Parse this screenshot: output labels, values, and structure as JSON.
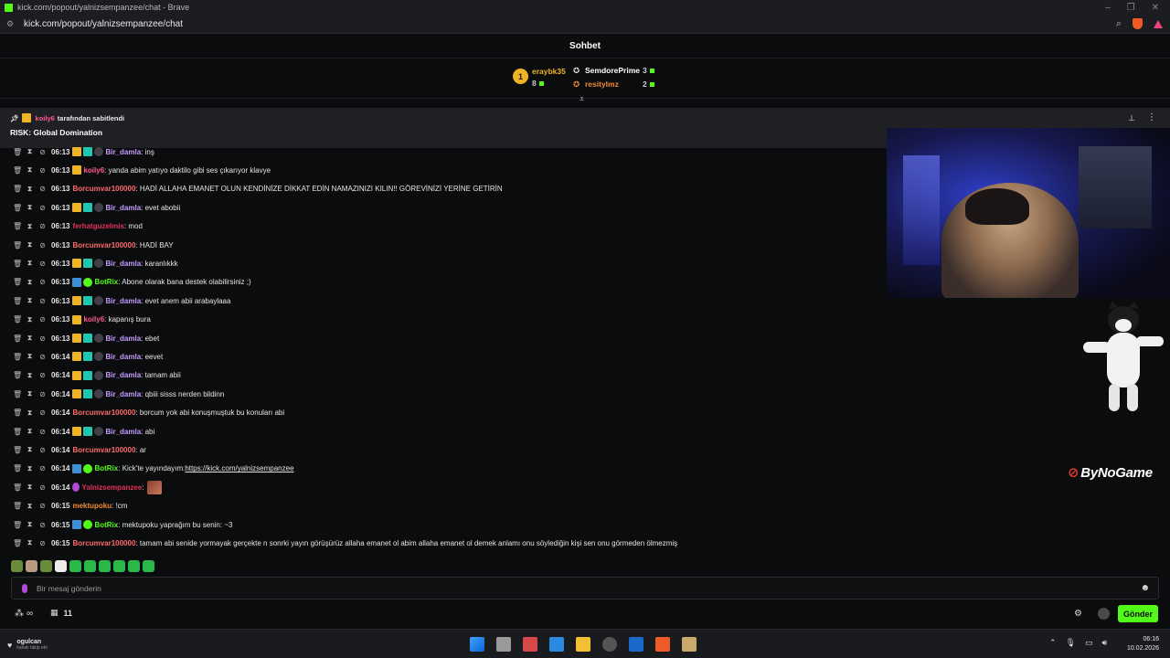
{
  "browser": {
    "title": "kick.com/popout/yalnizsempanzee/chat - Brave",
    "url": "kick.com/popout/yalnizsempanzee/chat"
  },
  "chat": {
    "title": "Sohbet",
    "leaderboard": {
      "first": {
        "rank": "1",
        "name": "eraybk35",
        "count": "8",
        "color": "#f0b325"
      },
      "second": {
        "name": "SemdorePrime",
        "count": "3",
        "color": "#ffffff"
      },
      "third": {
        "name": "resitylmz",
        "count": "2",
        "color": "#f08a35"
      }
    },
    "pinned": {
      "user": "koily6",
      "suffix": "tarafından sabitlendi",
      "text": "RISK: Global Domination"
    },
    "messages": [
      {
        "time": "06:13",
        "badges": [
          "crown",
          "sub",
          "vip"
        ],
        "user": "Bir_damla",
        "color": "#c79bff",
        "text": ": inş"
      },
      {
        "time": "06:13",
        "badges": [
          "crown"
        ],
        "user": "koily6",
        "color": "#ff5b8f",
        "text": ": yanda abim yatıyo daktilo gibi ses çıkarıyor klavye"
      },
      {
        "time": "06:13",
        "badges": [],
        "user": "Borcumvar100000",
        "color": "#ff6a6a",
        "text": ": HADİ ALLAHA EMANET OLUN KENDİNİZE DİKKAT EDİN NAMAZINIZI KILIN!! GÖREVİNİZİ YERİNE GETİRİN"
      },
      {
        "time": "06:13",
        "badges": [
          "crown",
          "sub",
          "vip"
        ],
        "user": "Bir_damla",
        "color": "#c79bff",
        "text": ": evet abobii"
      },
      {
        "time": "06:13",
        "badges": [],
        "user": "ferhatguzelmis",
        "color": "#e0335a",
        "text": ": mod"
      },
      {
        "time": "06:13",
        "badges": [],
        "user": "Borcumvar100000",
        "color": "#ff6a6a",
        "text": ": HADİ BAY"
      },
      {
        "time": "06:13",
        "badges": [
          "crown",
          "sub",
          "vip"
        ],
        "user": "Bir_damla",
        "color": "#c79bff",
        "text": ": karanlıkkk"
      },
      {
        "time": "06:13",
        "badges": [
          "bot",
          "ver"
        ],
        "user": "BotRix",
        "color": "#53fc18",
        "text": ": Abone olarak bana destek olabilirsiniz ;)"
      },
      {
        "time": "06:13",
        "badges": [
          "crown",
          "sub",
          "vip"
        ],
        "user": "Bir_damla",
        "color": "#c79bff",
        "text": ": evet anem abii arabaylaaa"
      },
      {
        "time": "06:13",
        "badges": [
          "crown"
        ],
        "user": "koily6",
        "color": "#ff5b8f",
        "text": ": kapanış bura"
      },
      {
        "time": "06:13",
        "badges": [
          "crown",
          "sub",
          "vip"
        ],
        "user": "Bir_damla",
        "color": "#c79bff",
        "text": ": ebet"
      },
      {
        "time": "06:14",
        "badges": [
          "crown",
          "sub",
          "vip"
        ],
        "user": "Bir_damla",
        "color": "#c79bff",
        "text": ": eevet"
      },
      {
        "time": "06:14",
        "badges": [
          "crown",
          "sub",
          "vip"
        ],
        "user": "Bir_damla",
        "color": "#c79bff",
        "text": ": tamam abii"
      },
      {
        "time": "06:14",
        "badges": [
          "crown",
          "sub",
          "vip"
        ],
        "user": "Bir_damla",
        "color": "#c79bff",
        "text": ": qbiii sisss nerden bildinn"
      },
      {
        "time": "06:14",
        "badges": [],
        "user": "Borcumvar100000",
        "color": "#ff6a6a",
        "text": ": borcum yok abi konuşmuştuk bu konuları abi"
      },
      {
        "time": "06:14",
        "badges": [
          "crown",
          "sub",
          "vip"
        ],
        "user": "Bir_damla",
        "color": "#c79bff",
        "text": ": abi"
      },
      {
        "time": "06:14",
        "badges": [],
        "user": "Borcumvar100000",
        "color": "#ff6a6a",
        "text": ": ar"
      },
      {
        "time": "06:14",
        "badges": [
          "bot",
          "ver"
        ],
        "user": "BotRix",
        "color": "#53fc18",
        "text": ": Kick'te yayındayım: ",
        "link": "https://kick.com/yalnizsempanzee"
      },
      {
        "time": "06:14",
        "badges": [
          "gem"
        ],
        "user": "Yalnizsempanzee",
        "color": "#e0335a",
        "text": ":",
        "emote": true
      },
      {
        "time": "06:15",
        "badges": [],
        "user": "mektupoku",
        "color": "#f08a35",
        "text": ": !cm"
      },
      {
        "time": "06:15",
        "badges": [
          "bot",
          "ver"
        ],
        "user": "BotRix",
        "color": "#53fc18",
        "text": ": mektupoku yaprağım bu senin: ~3"
      },
      {
        "time": "06:15",
        "badges": [],
        "user": "Borcumvar100000",
        "color": "#ff6a6a",
        "text": ": tamam abi senide yormayak gerçekte n sonrki yayın görüşürüz allaha emanet ol abim allaha emanet ol demek anlamı onu söylediğin kişi sen onu görmeden ölmezmiş"
      }
    ],
    "input_placeholder": "Bir mesaj gönderin",
    "points_label": "∞",
    "gift_count": "11",
    "send_label": "Gönder"
  },
  "watermark": "ByNoGame",
  "taskbar": {
    "follow_name": "ogulcan",
    "follow_sub": "kanalı takip etti",
    "time": "06:16",
    "date": "10.02.2026"
  }
}
